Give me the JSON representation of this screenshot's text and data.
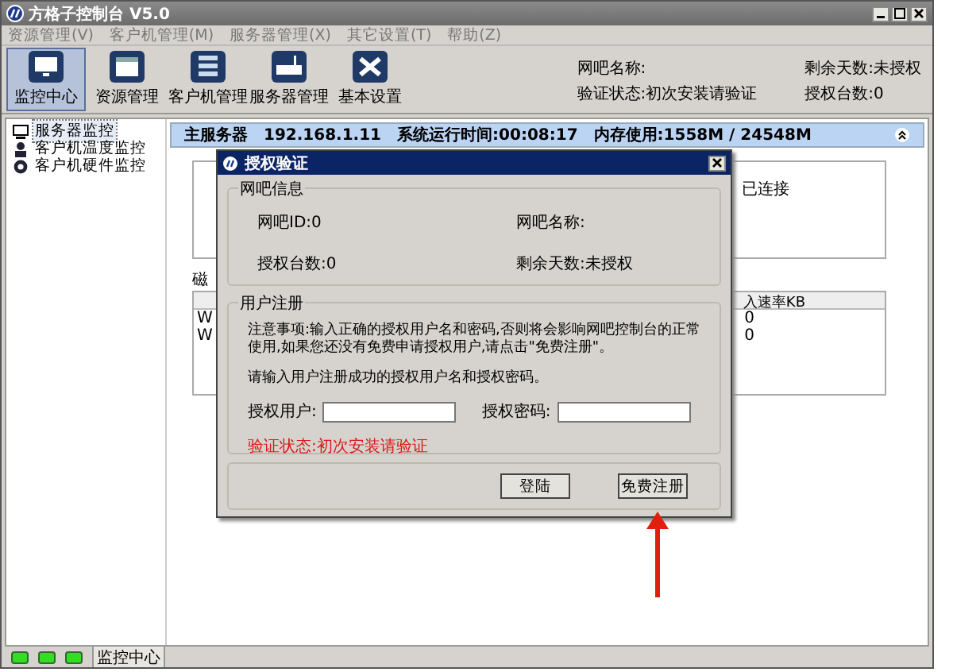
{
  "window": {
    "title": "方格子控制台 V5.0"
  },
  "menu": [
    "资源管理(V)",
    "客户机管理(M)",
    "服务器管理(X)",
    "其它设置(T)",
    "帮助(Z)"
  ],
  "toolbar": [
    {
      "label": "监控中心",
      "kind": "monitor",
      "selected": true
    },
    {
      "label": "资源管理",
      "kind": "window",
      "selected": false
    },
    {
      "label": "客户机管理",
      "kind": "grid",
      "selected": false
    },
    {
      "label": "服务器管理",
      "kind": "server",
      "selected": false
    },
    {
      "label": "基本设置",
      "kind": "tools",
      "selected": false
    }
  ],
  "info": {
    "cafe_name": "网吧名称:",
    "verify_status": "验证状态:初次安装请验证",
    "days_left": "剩余天数:未授权",
    "seats": "授权台数:0"
  },
  "sidebar": {
    "items": [
      {
        "label": "服务器监控",
        "kind": "monitor",
        "selected": true
      },
      {
        "label": "客户机温度监控",
        "kind": "person",
        "selected": false
      },
      {
        "label": "客户机硬件监控",
        "kind": "gear",
        "selected": false
      }
    ]
  },
  "server_bar": {
    "name": "主服务器",
    "ip": "192.168.1.11",
    "uptime": "系统运行时间:00:08:17",
    "memory": "内存使用:1558M / 24548M"
  },
  "background": {
    "connected": "已连接",
    "group_label": "磁",
    "table_header": "入速率KB",
    "rows": [
      {
        "column_1": "W",
        "column_2": "0"
      },
      {
        "column_1": "W",
        "column_2": "0"
      }
    ]
  },
  "dialog": {
    "title": "授权验证",
    "info_group": {
      "title": "网吧信息",
      "cafe_id": "网吧ID:0",
      "cafe_name": "网吧名称:",
      "seats": "授权台数:0",
      "days_left": "剩余天数:未授权"
    },
    "register_group": {
      "title": "用户注册",
      "notice": "注意事项:输入正确的授权用户名和密码,否则将会影响网吧控制台的正常使用,如果您还没有免费申请授权用户,请点击\"免费注册\"。",
      "prompt": "请输入用户注册成功的授权用户名和授权密码。",
      "user_label": "授权用户:",
      "password_label": "授权密码:",
      "status": "验证状态:初次安装请验证"
    },
    "buttons": [
      "登陆",
      "免费注册"
    ]
  },
  "status_bar": {
    "leds": [
      {
        "on": true
      },
      {
        "on": true
      },
      {
        "on": true
      }
    ],
    "tab": "监控中心"
  }
}
